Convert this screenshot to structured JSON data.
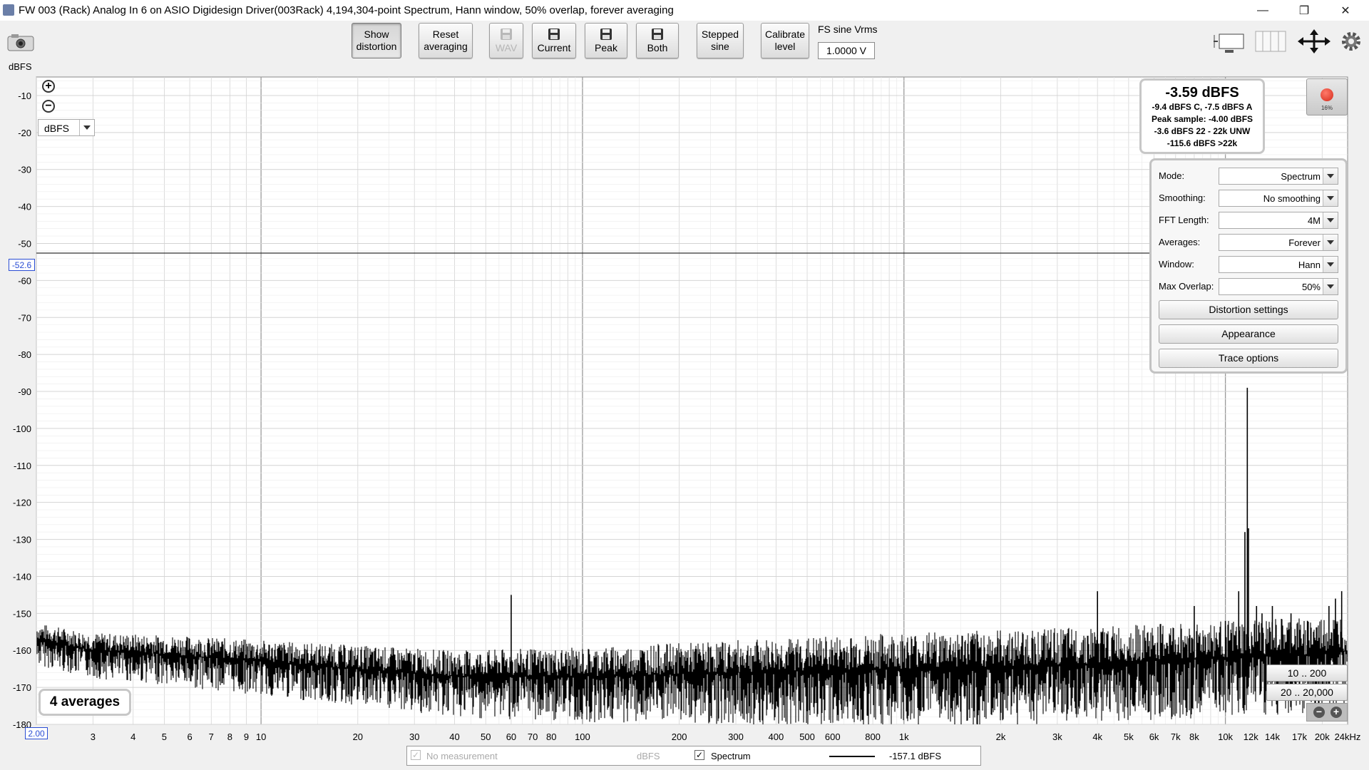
{
  "window": {
    "title": "FW 003 (Rack) Analog In 6 on ASIO Digidesign Driver(003Rack) 4,194,304-point Spectrum, Hann window, 50% overlap, forever averaging",
    "minimize": "—",
    "restore": "❐",
    "close": "✕"
  },
  "toolbar": {
    "show_distortion": [
      "Show",
      "distortion"
    ],
    "reset_averaging": [
      "Reset",
      "averaging"
    ],
    "wav": "WAV",
    "current": "Current",
    "peak": "Peak",
    "both": "Both",
    "stepped_sine": [
      "Stepped",
      "sine"
    ],
    "calibrate_level": [
      "Calibrate",
      "level"
    ],
    "fs_label": "FS sine Vrms",
    "fs_value": "1.0000 V"
  },
  "stats": {
    "main": "-3.59 dBFS",
    "lines": [
      "-9.4 dBFS C, -7.5 dBFS A",
      "Peak sample: -4.00 dBFS",
      "-3.6 dBFS 22 - 22k UNW",
      "-115.6 dBFS >22k"
    ]
  },
  "record": {
    "percent": "16%"
  },
  "settings": {
    "rows": [
      {
        "label": "Mode:",
        "value": "Spectrum"
      },
      {
        "label": "Smoothing:",
        "value": "No  smoothing"
      },
      {
        "label": "FFT Length:",
        "value": "4M"
      },
      {
        "label": "Averages:",
        "value": "Forever"
      },
      {
        "label": "Window:",
        "value": "Hann"
      },
      {
        "label": "Max Overlap:",
        "value": "50%"
      }
    ],
    "buttons": [
      "Distortion settings",
      "Appearance",
      "Trace options"
    ]
  },
  "unit_select": "dBFS",
  "averages_label": "4 averages",
  "range_buttons": [
    "10 .. 200",
    "20 .. 20,000"
  ],
  "cursor": {
    "level": "-52.6",
    "freq": "2.00"
  },
  "legend": {
    "no_measurement": "No measurement",
    "no_measurement_unit": "dBFS",
    "spectrum": "Spectrum",
    "spectrum_value": "-157.1 dBFS"
  },
  "colors": {
    "trace": "#000000",
    "cursor": "#2a4dd4",
    "grid_major": "#9a9a9a",
    "grid_minor": "#d4d4d4"
  },
  "chart_data": {
    "type": "line",
    "ylabel": "dBFS",
    "ylim": [
      -180,
      -5
    ],
    "xscale": "log",
    "xlim": [
      2,
      24000
    ],
    "y_ticks": [
      -10,
      -20,
      -30,
      -40,
      -50,
      -60,
      -70,
      -80,
      -90,
      -100,
      -110,
      -120,
      -130,
      -140,
      -150,
      -160,
      -170,
      -180
    ],
    "x_ticks": [
      {
        "v": 3,
        "t": "3"
      },
      {
        "v": 4,
        "t": "4"
      },
      {
        "v": 5,
        "t": "5"
      },
      {
        "v": 6,
        "t": "6"
      },
      {
        "v": 7,
        "t": "7"
      },
      {
        "v": 8,
        "t": "8"
      },
      {
        "v": 9,
        "t": "9"
      },
      {
        "v": 10,
        "t": "10"
      },
      {
        "v": 20,
        "t": "20"
      },
      {
        "v": 30,
        "t": "30"
      },
      {
        "v": 40,
        "t": "40"
      },
      {
        "v": 50,
        "t": "50"
      },
      {
        "v": 60,
        "t": "60"
      },
      {
        "v": 70,
        "t": "70"
      },
      {
        "v": 80,
        "t": "80"
      },
      {
        "v": 100,
        "t": "100"
      },
      {
        "v": 200,
        "t": "200"
      },
      {
        "v": 300,
        "t": "300"
      },
      {
        "v": 400,
        "t": "400"
      },
      {
        "v": 500,
        "t": "500"
      },
      {
        "v": 600,
        "t": "600"
      },
      {
        "v": 800,
        "t": "800"
      },
      {
        "v": 1000,
        "t": "1k"
      },
      {
        "v": 2000,
        "t": "2k"
      },
      {
        "v": 3000,
        "t": "3k"
      },
      {
        "v": 4000,
        "t": "4k"
      },
      {
        "v": 5000,
        "t": "5k"
      },
      {
        "v": 6000,
        "t": "6k"
      },
      {
        "v": 7000,
        "t": "7k"
      },
      {
        "v": 8000,
        "t": "8k"
      },
      {
        "v": 10000,
        "t": "10k"
      },
      {
        "v": 12000,
        "t": "12k"
      },
      {
        "v": 14000,
        "t": "14k"
      },
      {
        "v": 17000,
        "t": "17k"
      },
      {
        "v": 20000,
        "t": "20k"
      },
      {
        "v": 24000,
        "t": "24kHz"
      }
    ],
    "series": [
      {
        "floor": [
          [
            2,
            -157
          ],
          [
            3,
            -160
          ],
          [
            5,
            -161
          ],
          [
            10,
            -163
          ],
          [
            20,
            -165
          ],
          [
            40,
            -167
          ],
          [
            100,
            -167
          ],
          [
            300,
            -166
          ],
          [
            1000,
            -165
          ],
          [
            3000,
            -164
          ],
          [
            10000,
            -162
          ],
          [
            20000,
            -161
          ],
          [
            24000,
            -160
          ]
        ],
        "spikes": [
          [
            60,
            -145
          ],
          [
            1000,
            -167
          ],
          [
            4000,
            -144
          ],
          [
            8000,
            -148
          ],
          [
            10000,
            -152
          ],
          [
            11000,
            -144
          ],
          [
            11500,
            -128
          ],
          [
            11700,
            -89
          ],
          [
            11800,
            -127
          ],
          [
            12500,
            -148
          ],
          [
            13000,
            -150
          ],
          [
            14000,
            -148
          ],
          [
            16000,
            -150
          ],
          [
            18000,
            -152
          ],
          [
            21000,
            -148
          ],
          [
            22000,
            -146
          ],
          [
            23000,
            -144
          ]
        ]
      }
    ],
    "cursor_level": -52.6,
    "cursor_freq": 2
  }
}
